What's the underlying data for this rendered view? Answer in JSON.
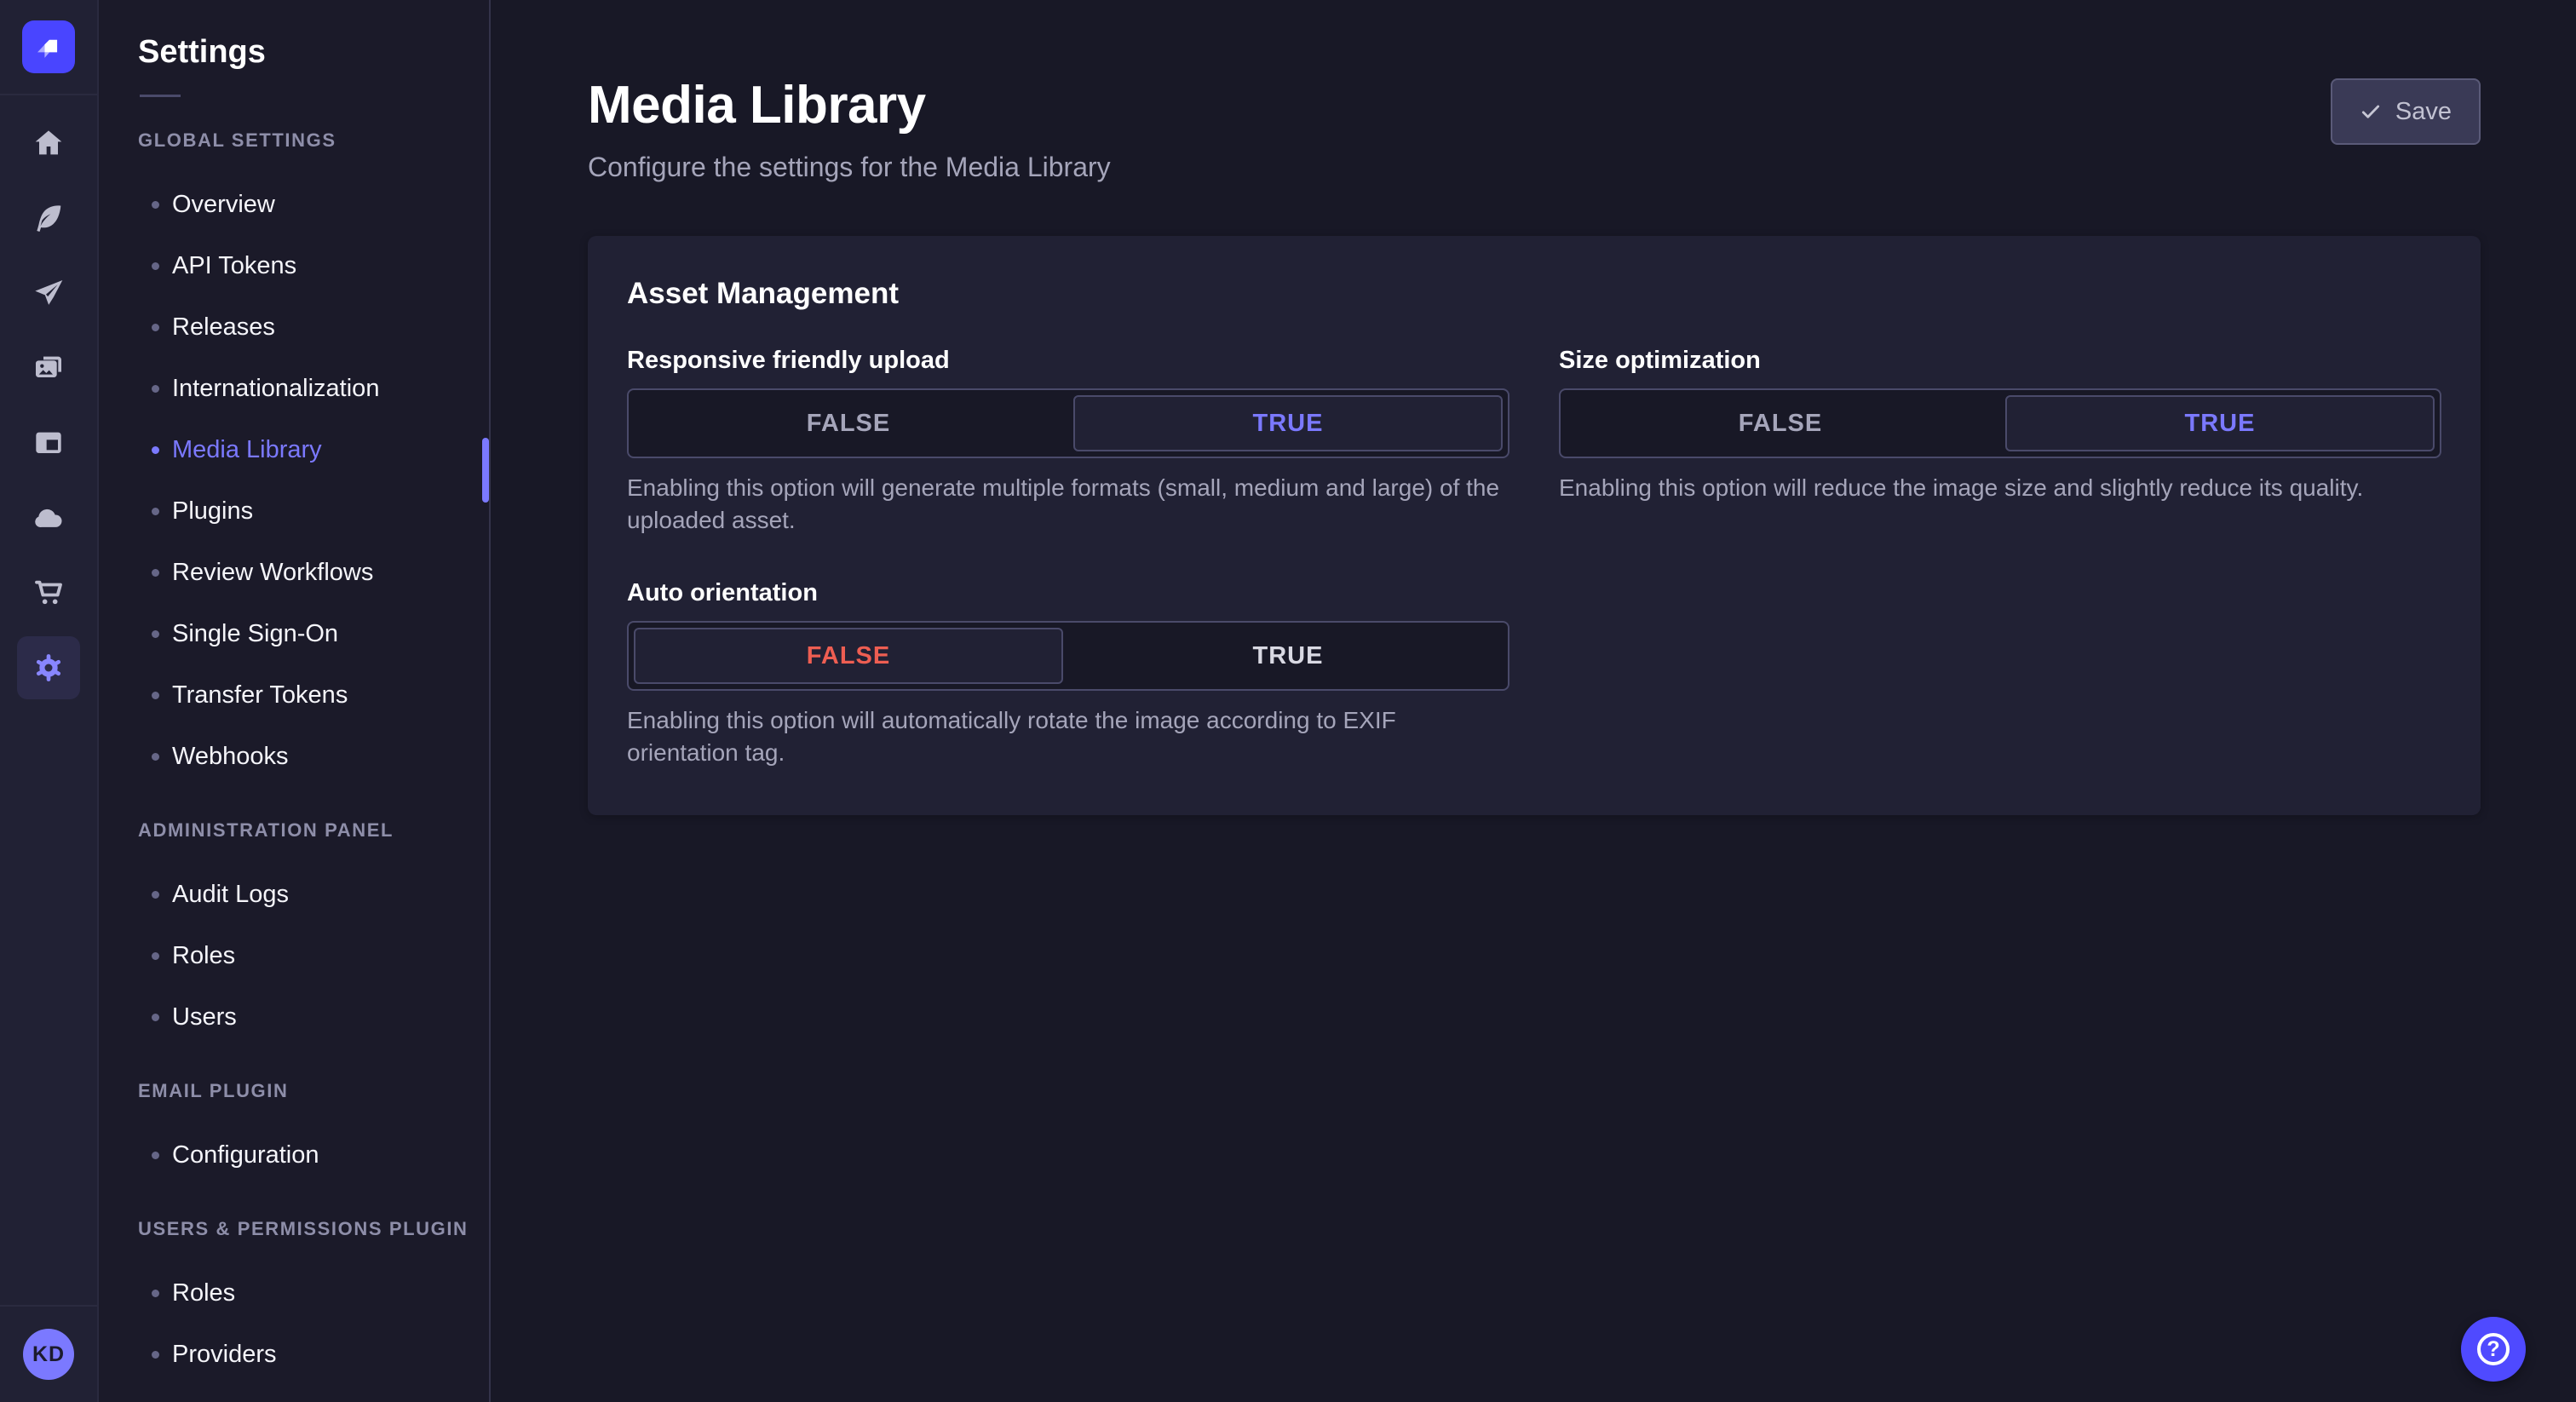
{
  "colors": {
    "brand": "#4945ff",
    "primary_light": "#7b79ff",
    "danger": "#ee5e52"
  },
  "rail": {
    "logo_name": "strapi-logo",
    "items": [
      {
        "name": "home"
      },
      {
        "name": "content-feather"
      },
      {
        "name": "release-plane"
      },
      {
        "name": "media-pictures"
      },
      {
        "name": "marketplace-layout"
      },
      {
        "name": "deploy-cloud"
      },
      {
        "name": "purchase-cart"
      },
      {
        "name": "settings-gear",
        "active": true
      }
    ],
    "avatar_initials": "KD"
  },
  "subnav": {
    "title": "Settings",
    "sections": [
      {
        "label": "GLOBAL SETTINGS",
        "items": [
          {
            "label": "Overview"
          },
          {
            "label": "API Tokens"
          },
          {
            "label": "Releases"
          },
          {
            "label": "Internationalization"
          },
          {
            "label": "Media Library",
            "active": true
          },
          {
            "label": "Plugins"
          },
          {
            "label": "Review Workflows"
          },
          {
            "label": "Single Sign-On"
          },
          {
            "label": "Transfer Tokens"
          },
          {
            "label": "Webhooks"
          }
        ]
      },
      {
        "label": "ADMINISTRATION PANEL",
        "items": [
          {
            "label": "Audit Logs"
          },
          {
            "label": "Roles"
          },
          {
            "label": "Users"
          }
        ]
      },
      {
        "label": "EMAIL PLUGIN",
        "items": [
          {
            "label": "Configuration"
          }
        ]
      },
      {
        "label": "USERS & PERMISSIONS PLUGIN",
        "items": [
          {
            "label": "Roles"
          },
          {
            "label": "Providers"
          }
        ]
      }
    ]
  },
  "header": {
    "title": "Media Library",
    "subtitle": "Configure the settings for the Media Library",
    "save_label": "Save"
  },
  "card": {
    "title": "Asset Management",
    "fields": [
      {
        "label": "Responsive friendly upload",
        "options": {
          "false": "FALSE",
          "true": "TRUE"
        },
        "value": "TRUE",
        "hint": "Enabling this option will generate multiple formats (small, medium and large) of the uploaded asset."
      },
      {
        "label": "Size optimization",
        "options": {
          "false": "FALSE",
          "true": "TRUE"
        },
        "value": "TRUE",
        "hint": "Enabling this option will reduce the image size and slightly reduce its quality."
      },
      {
        "label": "Auto orientation",
        "options": {
          "false": "FALSE",
          "true": "TRUE"
        },
        "value": "FALSE",
        "hint": "Enabling this option will automatically rotate the image according to EXIF orientation tag."
      }
    ]
  },
  "help": {
    "glyph": "?"
  }
}
